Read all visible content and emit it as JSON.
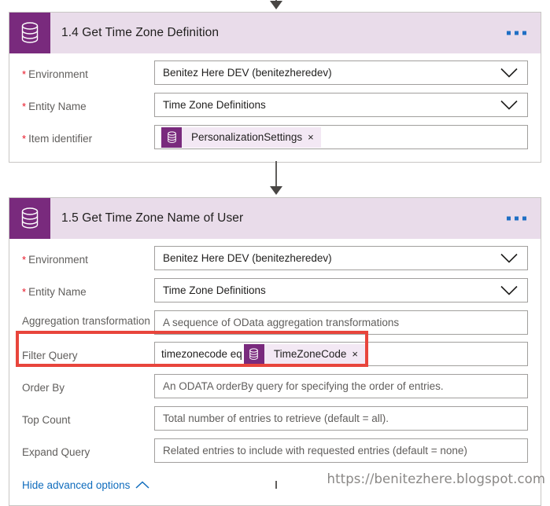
{
  "theme": {
    "accent_purple": "#792a7d",
    "header_band": "#e9dcea",
    "chip_bg": "#f3e8f4",
    "link_blue": "#0f6cbd",
    "required_red": "#e81123",
    "annotation_red": "#e8453c",
    "border_gray": "#a19f9d",
    "label_gray": "#605e5c"
  },
  "icons": {
    "connector_arrow": "down-arrow-icon",
    "step_action": "database-icon",
    "overflow_menu": "ellipsis-icon",
    "dropdown": "chevron-down-icon",
    "collapse": "chevron-up-icon",
    "remove_token": "close-icon"
  },
  "cards": [
    {
      "id": "step-1-4",
      "title": "1.4 Get Time Zone Definition",
      "icon": "database-icon",
      "overflow_label": "…",
      "rows": [
        {
          "label": "Environment",
          "required": true,
          "kind": "dropdown",
          "value": "Benitez Here DEV (benitezheredev)",
          "placeholder": ""
        },
        {
          "label": "Entity Name",
          "required": true,
          "kind": "dropdown",
          "value": "Time Zone Definitions",
          "placeholder": ""
        },
        {
          "label": "Item identifier",
          "required": true,
          "kind": "token",
          "pretext": "",
          "token": "PersonalizationSettings",
          "token_remove": "×",
          "value": "",
          "placeholder": ""
        }
      ],
      "footer": null
    },
    {
      "id": "step-1-5",
      "title": "1.5 Get Time Zone Name of User",
      "icon": "database-icon",
      "overflow_label": "…",
      "rows": [
        {
          "label": "Environment",
          "required": true,
          "kind": "dropdown",
          "value": "Benitez Here DEV (benitezheredev)",
          "placeholder": ""
        },
        {
          "label": "Entity Name",
          "required": true,
          "kind": "dropdown",
          "value": "Time Zone Definitions",
          "placeholder": ""
        },
        {
          "label": "Aggregation transformation",
          "required": false,
          "kind": "text",
          "value": "",
          "placeholder": "A sequence of OData aggregation transformations"
        },
        {
          "label": "Filter Query",
          "required": false,
          "kind": "token",
          "pretext": "timezonecode eq",
          "token": "TimeZoneCode",
          "token_remove": "×",
          "value": "",
          "placeholder": "",
          "highlighted": true
        },
        {
          "label": "Order By",
          "required": false,
          "kind": "text",
          "value": "",
          "placeholder": "An ODATA orderBy query for specifying the order of entries."
        },
        {
          "label": "Top Count",
          "required": false,
          "kind": "text",
          "value": "",
          "placeholder": "Total number of entries to retrieve (default = all)."
        },
        {
          "label": "Expand Query",
          "required": false,
          "kind": "text",
          "value": "",
          "placeholder": "Related entries to include with requested entries (default = none)"
        }
      ],
      "footer": {
        "label": "Hide advanced options"
      }
    }
  ],
  "watermark": "https://benitezhere.blogspot.com"
}
